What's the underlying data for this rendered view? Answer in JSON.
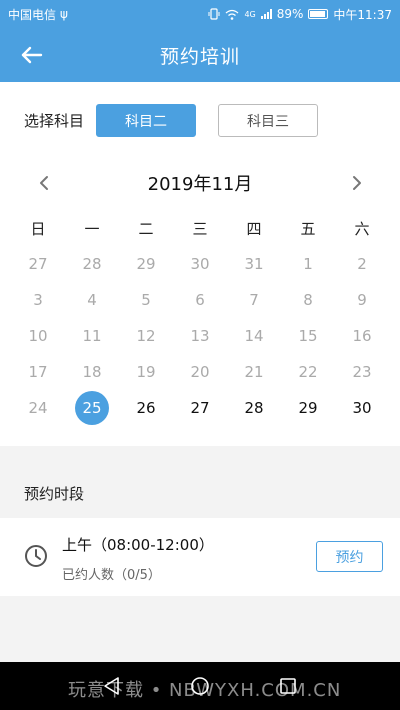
{
  "status_bar": {
    "carrier": "中国电信",
    "usb": "ψ",
    "network": "4G",
    "battery": "89%",
    "time": "中午11:37"
  },
  "header": {
    "title": "预约培训"
  },
  "subject": {
    "label": "选择科目",
    "options": [
      "科目二",
      "科目三"
    ],
    "selected": "科目二"
  },
  "calendar": {
    "month": "2019年11月",
    "weekdays": [
      "日",
      "一",
      "二",
      "三",
      "四",
      "五",
      "六"
    ],
    "weeks": [
      [
        "27",
        "28",
        "29",
        "30",
        "31",
        "1",
        "2"
      ],
      [
        "3",
        "4",
        "5",
        "6",
        "7",
        "8",
        "9"
      ],
      [
        "10",
        "11",
        "12",
        "13",
        "14",
        "15",
        "16"
      ],
      [
        "17",
        "18",
        "19",
        "20",
        "21",
        "22",
        "23"
      ],
      [
        "24",
        "25",
        "26",
        "27",
        "28",
        "29",
        "30"
      ]
    ],
    "selected_day": "25"
  },
  "section": {
    "title": "预约时段"
  },
  "slot": {
    "time": "上午（08:00-12:00）",
    "count": "已约人数（0/5）",
    "button": "预约"
  },
  "watermark": "玩意下载 • NBWYXH.COM.CN",
  "colors": {
    "accent": "#4ba0e0",
    "disabled_text": "#aaaaaa",
    "band": "#f3f3f3"
  }
}
